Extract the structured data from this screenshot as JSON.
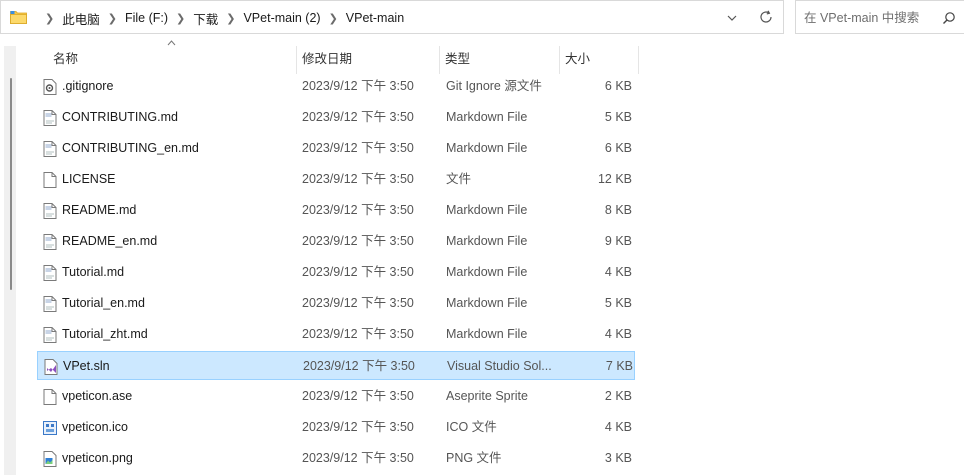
{
  "address": {
    "crumbs": [
      "此电脑",
      "File (F:)",
      "下载",
      "VPet-main (2)",
      "VPet-main"
    ]
  },
  "search": {
    "placeholder": "在 VPet-main 中搜索"
  },
  "columns": {
    "name": "名称",
    "date": "修改日期",
    "type": "类型",
    "size": "大小"
  },
  "files": [
    {
      "name": ".gitignore",
      "date": "2023/9/12 下午 3:50",
      "type": "Git Ignore 源文件",
      "size": "6 KB",
      "icon": "gear-file-icon"
    },
    {
      "name": "CONTRIBUTING.md",
      "date": "2023/9/12 下午 3:50",
      "type": "Markdown File",
      "size": "5 KB",
      "icon": "markdown-file-icon"
    },
    {
      "name": "CONTRIBUTING_en.md",
      "date": "2023/9/12 下午 3:50",
      "type": "Markdown File",
      "size": "6 KB",
      "icon": "markdown-file-icon"
    },
    {
      "name": "LICENSE",
      "date": "2023/9/12 下午 3:50",
      "type": "文件",
      "size": "12 KB",
      "icon": "blank-file-icon"
    },
    {
      "name": "README.md",
      "date": "2023/9/12 下午 3:50",
      "type": "Markdown File",
      "size": "8 KB",
      "icon": "markdown-file-icon"
    },
    {
      "name": "README_en.md",
      "date": "2023/9/12 下午 3:50",
      "type": "Markdown File",
      "size": "9 KB",
      "icon": "markdown-file-icon"
    },
    {
      "name": "Tutorial.md",
      "date": "2023/9/12 下午 3:50",
      "type": "Markdown File",
      "size": "4 KB",
      "icon": "markdown-file-icon"
    },
    {
      "name": "Tutorial_en.md",
      "date": "2023/9/12 下午 3:50",
      "type": "Markdown File",
      "size": "5 KB",
      "icon": "markdown-file-icon"
    },
    {
      "name": "Tutorial_zht.md",
      "date": "2023/9/12 下午 3:50",
      "type": "Markdown File",
      "size": "4 KB",
      "icon": "markdown-file-icon"
    },
    {
      "name": "VPet.sln",
      "date": "2023/9/12 下午 3:50",
      "type": "Visual Studio Sol...",
      "size": "7 KB",
      "icon": "visual-studio-solution-icon",
      "selected": true
    },
    {
      "name": "vpeticon.ase",
      "date": "2023/9/12 下午 3:50",
      "type": "Aseprite Sprite",
      "size": "2 KB",
      "icon": "aseprite-file-icon"
    },
    {
      "name": "vpeticon.ico",
      "date": "2023/9/12 下午 3:50",
      "type": "ICO 文件",
      "size": "4 KB",
      "icon": "ico-image-icon"
    },
    {
      "name": "vpeticon.png",
      "date": "2023/9/12 下午 3:50",
      "type": "PNG 文件",
      "size": "3 KB",
      "icon": "png-image-icon"
    }
  ],
  "colors": {
    "selection_bg": "#cce8ff",
    "selection_border": "#99d1ff",
    "folder": "#f8c746"
  }
}
